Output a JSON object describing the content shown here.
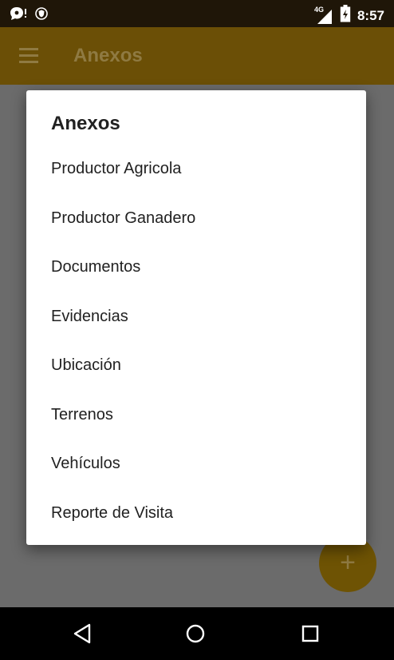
{
  "status_bar": {
    "time": "8:57",
    "network": "4G"
  },
  "app_bar": {
    "title": "Anexos"
  },
  "dialog": {
    "title": "Anexos",
    "items": [
      {
        "label": "Productor Agricola"
      },
      {
        "label": "Productor Ganadero"
      },
      {
        "label": "Documentos"
      },
      {
        "label": "Evidencias"
      },
      {
        "label": "Ubicación"
      },
      {
        "label": "Terrenos"
      },
      {
        "label": "Vehículos"
      },
      {
        "label": "Reporte de Visita"
      }
    ]
  },
  "fab": {
    "icon": "+"
  },
  "colors": {
    "app_bar_dimmed": "#6b4f06",
    "fab_dimmed": "#6e5304",
    "scrim": "#6b6b6b",
    "status_bar": "#1f1608"
  },
  "icons": {
    "status_left": [
      "chat-notification-icon",
      "shield-icon"
    ],
    "status_right": [
      "signal-icon",
      "battery-charging-icon"
    ],
    "navigation": [
      "back-icon",
      "home-icon",
      "recents-icon"
    ]
  }
}
